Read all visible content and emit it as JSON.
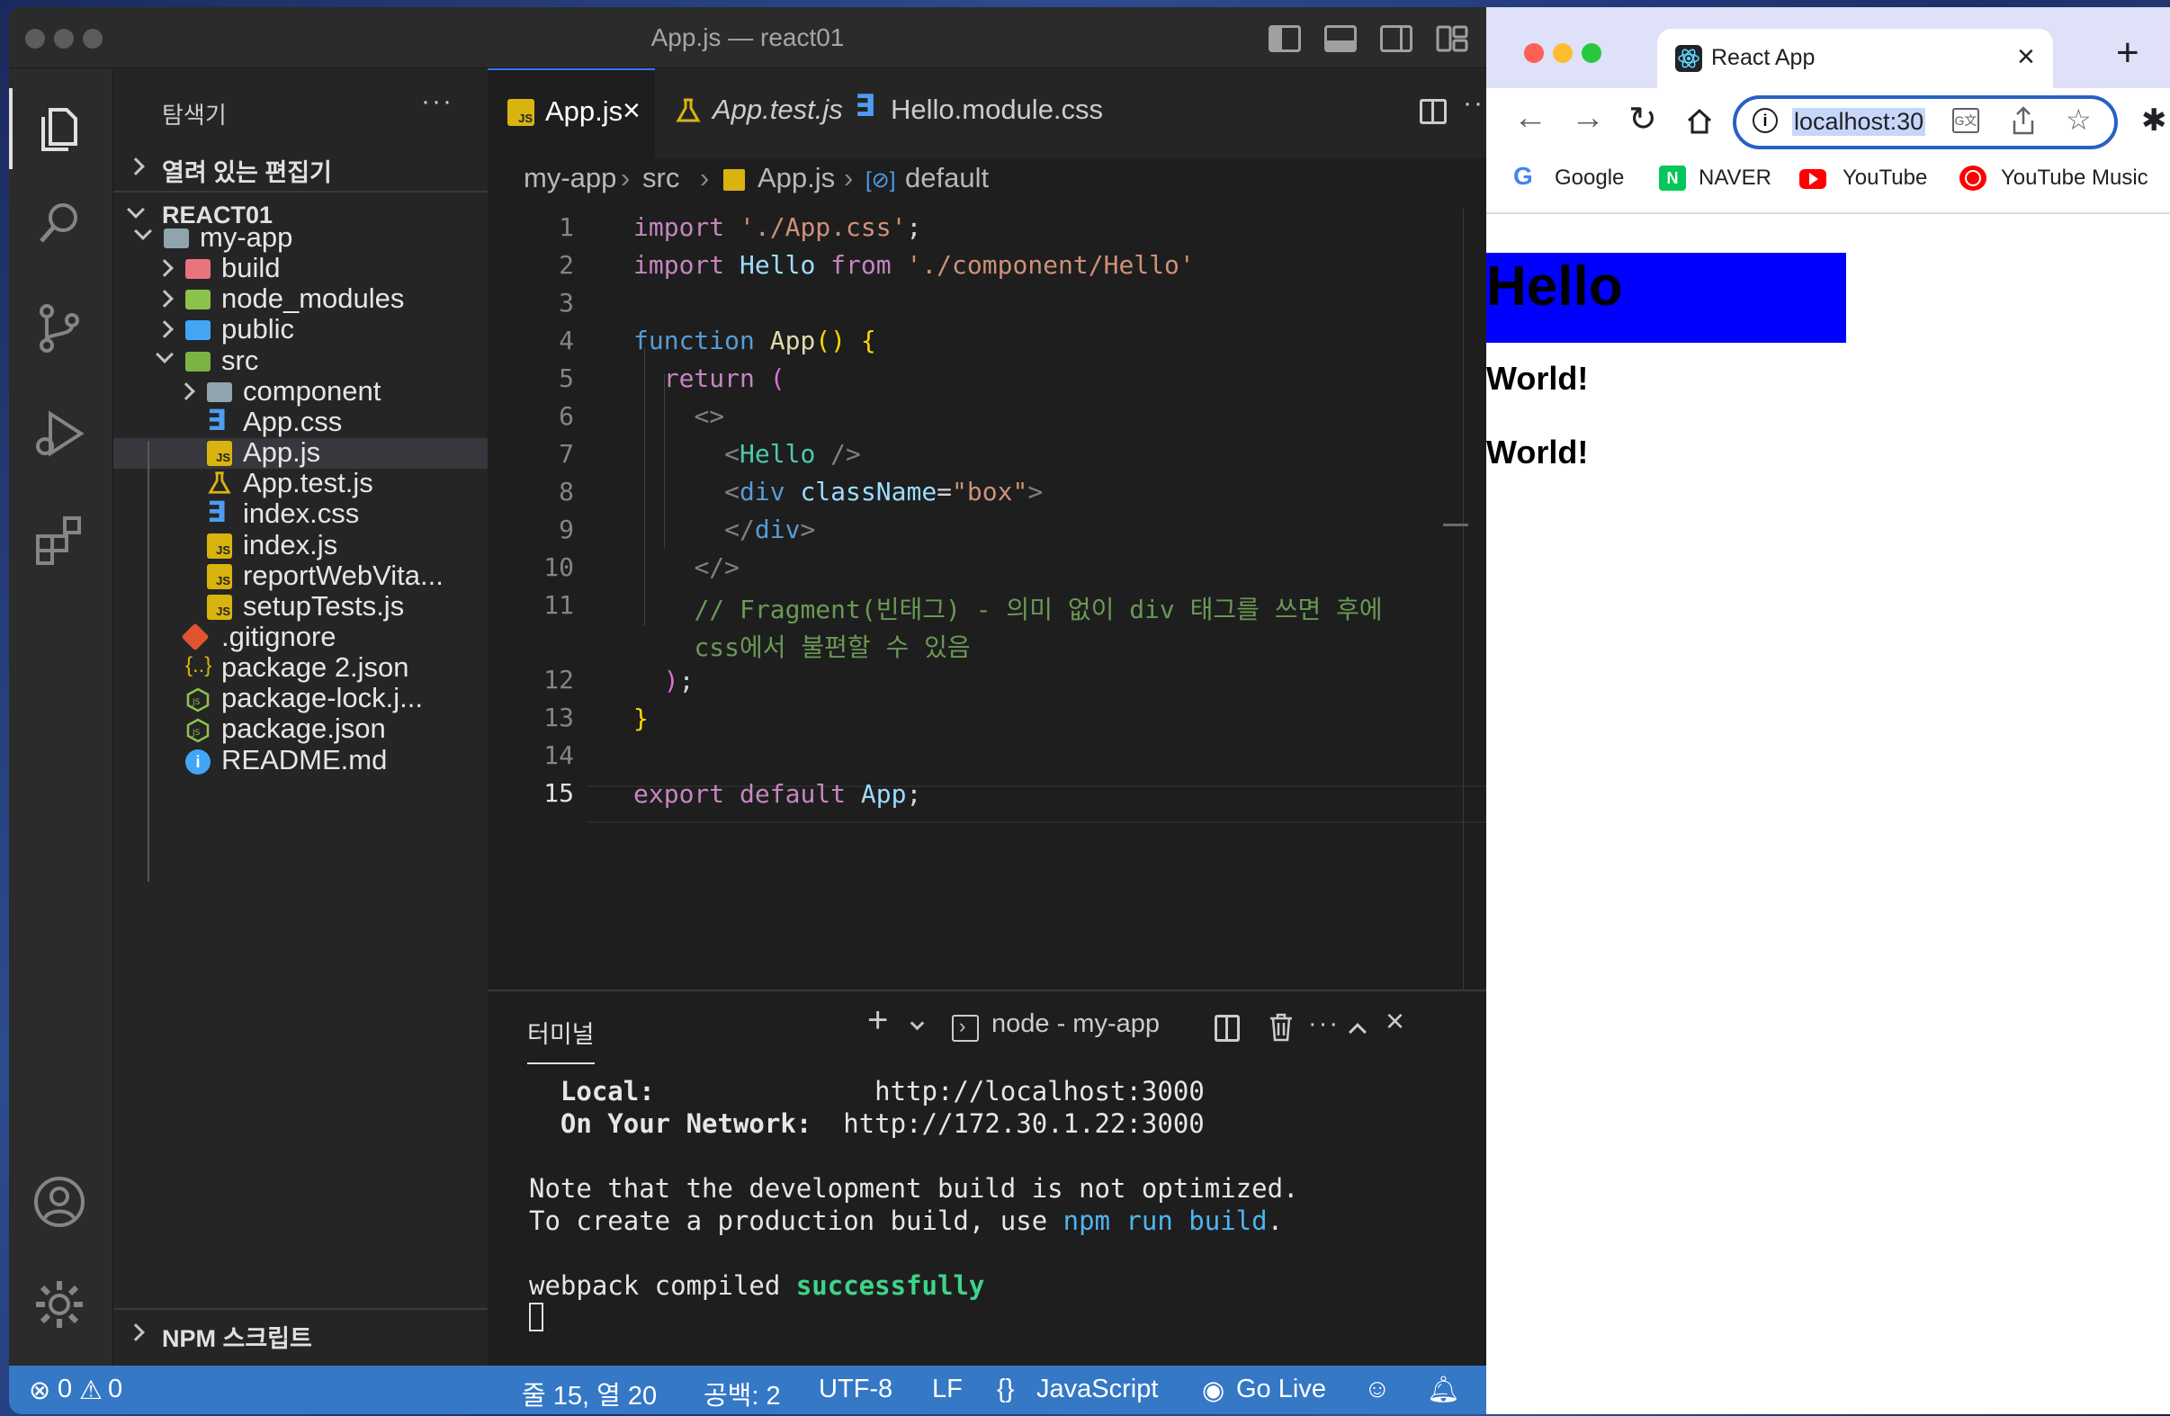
{
  "vscode": {
    "window_title": "App.js — react01",
    "explorer": {
      "title": "탐색기",
      "more": "···",
      "open_editors": "열려 있는 편집기",
      "project": "REACT01",
      "tree": [
        {
          "label": "my-app",
          "type": "folder-open"
        },
        {
          "label": "build",
          "type": "folder"
        },
        {
          "label": "node_modules",
          "type": "folder"
        },
        {
          "label": "public",
          "type": "folder"
        },
        {
          "label": "src",
          "type": "folder-open"
        },
        {
          "label": "component",
          "type": "folder"
        },
        {
          "label": "App.css",
          "type": "css"
        },
        {
          "label": "App.js",
          "type": "js"
        },
        {
          "label": "App.test.js",
          "type": "test"
        },
        {
          "label": "index.css",
          "type": "css"
        },
        {
          "label": "index.js",
          "type": "js"
        },
        {
          "label": "reportWebVita...",
          "type": "js"
        },
        {
          "label": "setupTests.js",
          "type": "js"
        },
        {
          "label": ".gitignore",
          "type": "git"
        },
        {
          "label": "package 2.json",
          "type": "json-braces"
        },
        {
          "label": "package-lock.j...",
          "type": "node"
        },
        {
          "label": "package.json",
          "type": "node"
        },
        {
          "label": "README.md",
          "type": "info"
        }
      ],
      "npm_scripts": "NPM 스크립트"
    },
    "tabs": [
      {
        "label": "App.js",
        "active": true
      },
      {
        "label": "App.test.js",
        "active": false
      },
      {
        "label": "Hello.module.css",
        "active": false
      }
    ],
    "breadcrumbs": [
      "my-app",
      "src",
      "App.js",
      "default"
    ],
    "code": {
      "line_numbers": [
        "1",
        "2",
        "3",
        "4",
        "5",
        "6",
        "7",
        "8",
        "9",
        "10",
        "11",
        "",
        "12",
        "13",
        "14",
        "15"
      ],
      "current_line": "15"
    },
    "terminal": {
      "tab_label": "터미널",
      "shell_label": "node - my-app",
      "local_label": "Local:",
      "local_url": "http://localhost:3000",
      "network_label": "On Your Network:",
      "network_url": "http://172.30.1.22:3000",
      "note_line": "Note that the development build is not optimized.",
      "create_prefix": "To create a production build, use ",
      "create_cmd": "npm run build",
      "create_suffix": ".",
      "compiled_prefix": "webpack compiled ",
      "compiled_status": "successfully"
    },
    "status_bar": {
      "errors": "0",
      "warnings": "0",
      "position": "줄 15, 열 20",
      "spaces": "공백: 2",
      "encoding": "UTF-8",
      "eol": "LF",
      "language": "JavaScript",
      "go_live": "Go Live"
    },
    "colors": {
      "accent": "#3478c6",
      "editor_bg": "#1e1e1e",
      "sidebar_bg": "#252526"
    }
  },
  "chrome": {
    "tab_title": "React App",
    "address": "localhost:30",
    "bookmarks": [
      "Google",
      "NAVER",
      "YouTube",
      "YouTube Music"
    ],
    "page": {
      "heading": "Hello",
      "lines": [
        "World!",
        "World!"
      ],
      "heading_bg": "#0000ff"
    }
  }
}
